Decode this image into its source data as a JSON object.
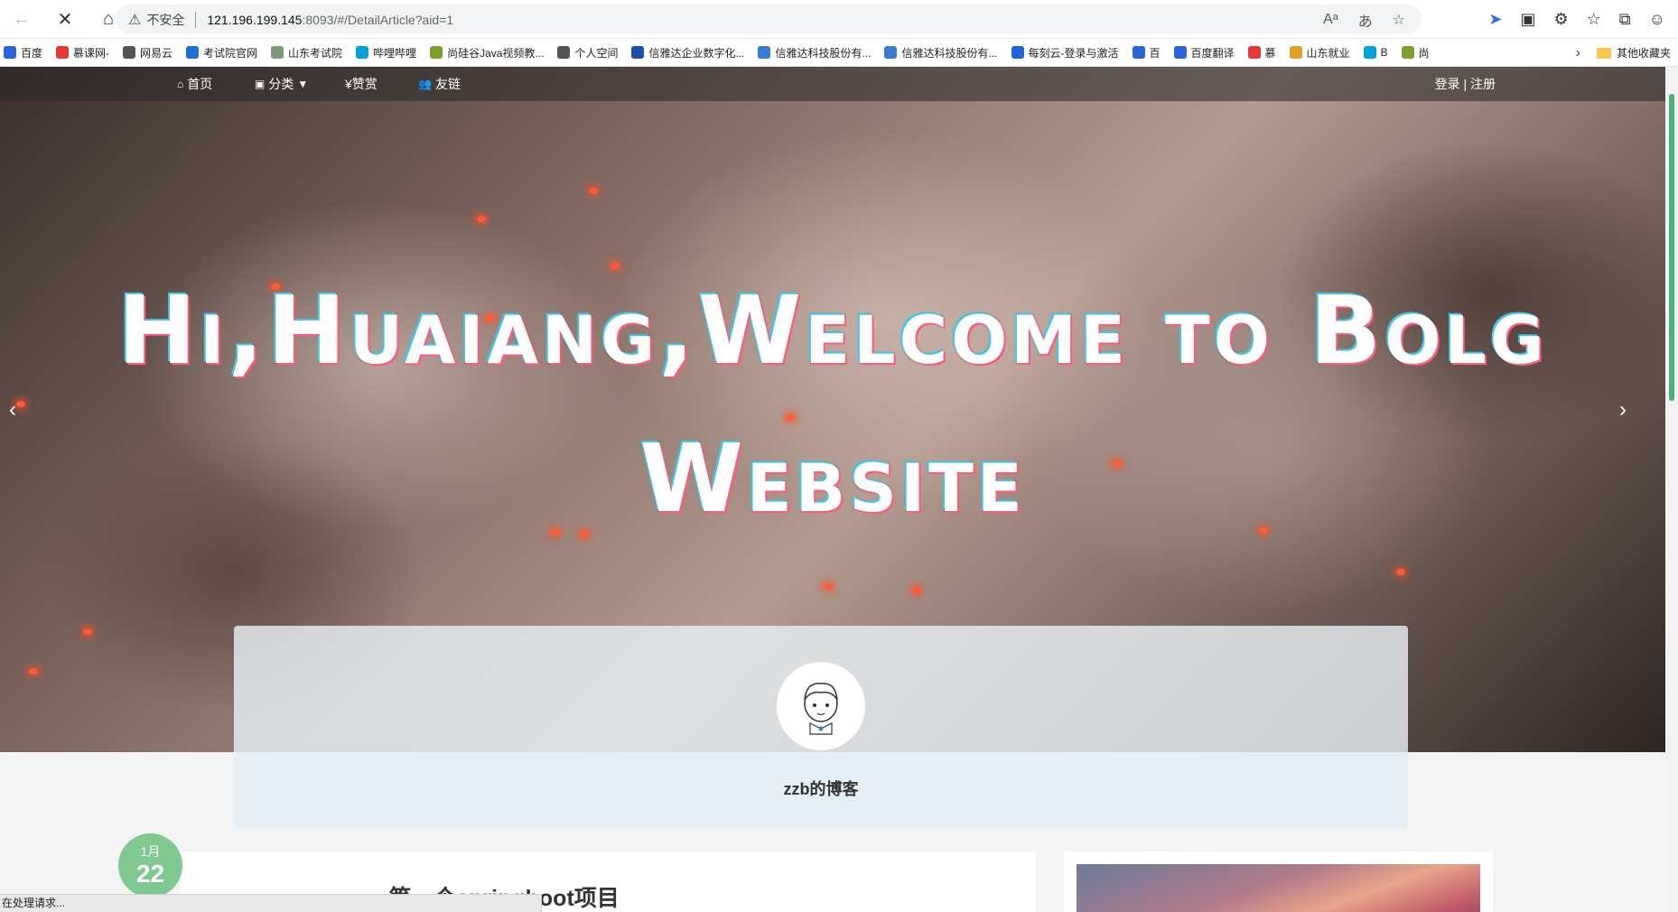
{
  "browser": {
    "url_warning": "不安全",
    "url_host": "121.196.199.145",
    "url_path": ":8093/#/DetailArticle?aid=1",
    "status_text": "在处理请求...",
    "bookmarks": [
      {
        "label": "百度",
        "color": "#2b63d9"
      },
      {
        "label": "慕课网-",
        "color": "#e53935"
      },
      {
        "label": "网易云",
        "color": "#555555"
      },
      {
        "label": "考试院官网",
        "color": "#1e6fd9"
      },
      {
        "label": "山东考试院",
        "color": "#7a9a7a"
      },
      {
        "label": "哔哩哔哩",
        "color": "#00a1d6"
      },
      {
        "label": "尚硅谷Java视频教...",
        "color": "#7c9e2a"
      },
      {
        "label": "个人空间",
        "color": "#555555"
      },
      {
        "label": "信雅达企业数字化...",
        "color": "#1e4fa8"
      },
      {
        "label": "信雅达科技股份有...",
        "color": "#3a7bd5"
      },
      {
        "label": "信雅达科技股份有...",
        "color": "#3a7bd5"
      },
      {
        "label": "每刻云-登录与激活",
        "color": "#1e63d9"
      },
      {
        "label": "百",
        "color": "#2b63d9"
      },
      {
        "label": "百度翻译",
        "color": "#2b63d9"
      },
      {
        "label": "慕",
        "color": "#e53935"
      },
      {
        "label": "山东就业",
        "color": "#e0a020"
      },
      {
        "label": "B",
        "color": "#00a1d6"
      },
      {
        "label": "尚",
        "color": "#7c9e2a"
      }
    ],
    "other_bookmarks": "其他收藏夹"
  },
  "nav": {
    "home": "首页",
    "category": "分类",
    "donate": "¥赞赏",
    "links": "友链",
    "login": "登录 | 注册"
  },
  "hero": {
    "line1": "Hi,Huaiang,Welcome to Bolg",
    "line2": "Website"
  },
  "profile": {
    "blog_name": "zzb的博客"
  },
  "article": {
    "title": "第一个springboot项目",
    "month": "1月",
    "day": "22"
  },
  "colors": {
    "accent_green": "#7fc88f",
    "scroll_green": "#4caf7a"
  }
}
